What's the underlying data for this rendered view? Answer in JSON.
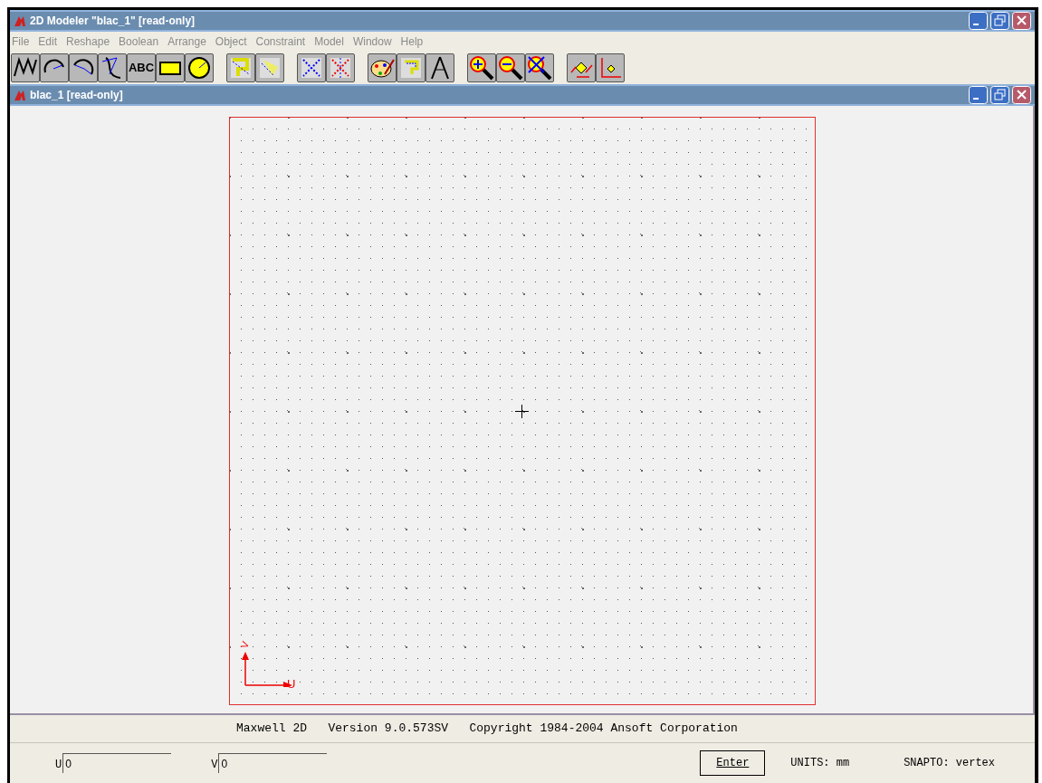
{
  "window": {
    "title": "2D Modeler \"blac_1\" [read-only]"
  },
  "menu": [
    "File",
    "Edit",
    "Reshape",
    "Boolean",
    "Arrange",
    "Object",
    "Constraint",
    "Model",
    "Window",
    "Help"
  ],
  "toolbar": [
    [
      {
        "kind": "polyline"
      },
      {
        "kind": "arc-cw"
      },
      {
        "kind": "arc-ccw"
      },
      {
        "kind": "spline"
      },
      {
        "kind": "text",
        "label": "ABC"
      },
      {
        "kind": "rectangle"
      },
      {
        "kind": "circle"
      }
    ],
    [
      {
        "kind": "hatch-a"
      },
      {
        "kind": "hatch-b"
      }
    ],
    [
      {
        "kind": "cross-blue"
      },
      {
        "kind": "cross-red"
      }
    ],
    [
      {
        "kind": "palette"
      },
      {
        "kind": "query"
      },
      {
        "kind": "compass"
      }
    ],
    [
      {
        "kind": "zoom-in"
      },
      {
        "kind": "zoom-out"
      },
      {
        "kind": "zoom-fit"
      }
    ],
    [
      {
        "kind": "rotate-axes"
      },
      {
        "kind": "axes"
      }
    ]
  ],
  "document": {
    "title": "blac_1 [read-only]",
    "axes": {
      "u_label": "U",
      "v_label": "V"
    }
  },
  "status": {
    "text": "Maxwell 2D   Version 9.0.573SV   Copyright 1984-2004 Ansoft Corporation"
  },
  "coords": [
    {
      "label": "U",
      "value": "0"
    },
    {
      "label": "V",
      "value": "0"
    }
  ],
  "enter_button": "Enter",
  "units": "UNITS: mm",
  "snap": "SNAPTO: vertex"
}
